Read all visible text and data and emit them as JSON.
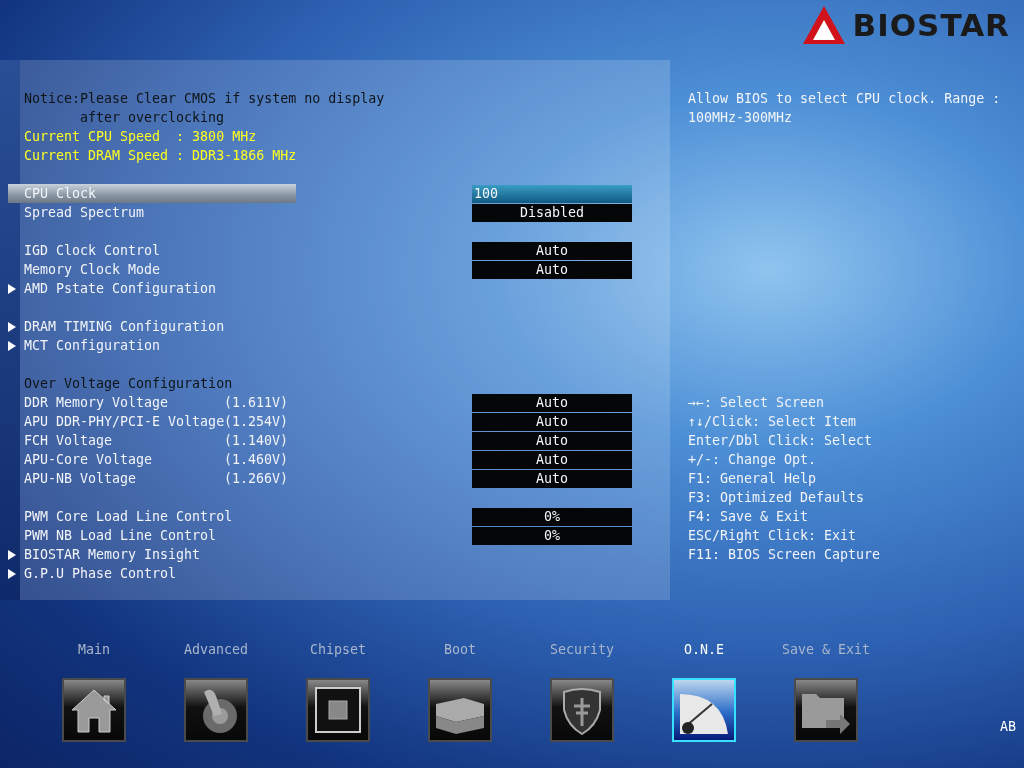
{
  "logo": {
    "text": "BIOSTAR"
  },
  "notice_lines": [
    "Notice:Please Clear CMOS if system no display",
    "after overclocking"
  ],
  "info_lines": [
    "Current CPU Speed  : 3800 MHz",
    "Current DRAM Speed : DDR3-1866 MHz"
  ],
  "sections": [
    {
      "items": [
        {
          "kind": "setting",
          "label": "CPU Clock",
          "value": "100",
          "selected": true
        },
        {
          "kind": "setting",
          "label": "Spread Spectrum",
          "value": "Disabled",
          "selected": false
        }
      ]
    },
    {
      "items": [
        {
          "kind": "setting",
          "label": "IGD Clock Control",
          "value": "Auto",
          "selected": false
        },
        {
          "kind": "setting",
          "label": "Memory Clock Mode",
          "value": "Auto",
          "selected": false
        },
        {
          "kind": "submenu",
          "label": "AMD Pstate Configuration",
          "selected": false
        }
      ]
    },
    {
      "items": [
        {
          "kind": "submenu",
          "label": "DRAM TIMING Configuration",
          "selected": false
        },
        {
          "kind": "submenu",
          "label": "MCT Configuration",
          "selected": false
        }
      ]
    },
    {
      "items": [
        {
          "kind": "header",
          "label": "Over Voltage Configuration"
        },
        {
          "kind": "setting",
          "label": "DDR Memory Voltage",
          "reading": "(1.611V)",
          "value": "Auto",
          "selected": false
        },
        {
          "kind": "setting",
          "label": "APU DDR-PHY/PCI-E Voltage",
          "reading": "(1.254V)",
          "value": "Auto",
          "selected": false
        },
        {
          "kind": "setting",
          "label": "FCH Voltage",
          "reading": "(1.140V)",
          "value": "Auto",
          "selected": false
        },
        {
          "kind": "setting",
          "label": "APU-Core Voltage",
          "reading": "(1.460V)",
          "value": "Auto",
          "selected": false
        },
        {
          "kind": "setting",
          "label": "APU-NB Voltage",
          "reading": "(1.266V)",
          "value": "Auto",
          "selected": false
        }
      ]
    },
    {
      "items": [
        {
          "kind": "setting",
          "label": "PWM Core Load Line Control",
          "value": "0%",
          "selected": false
        },
        {
          "kind": "setting",
          "label": "PWM NB Load Line Control",
          "value": "0%",
          "selected": false
        },
        {
          "kind": "submenu",
          "label": "BIOSTAR Memory Insight",
          "selected": false
        },
        {
          "kind": "submenu",
          "label": "G.P.U Phase Control",
          "selected": false
        }
      ]
    }
  ],
  "help_text": "Allow BIOS to select CPU clock. Range : 100MHz-300MHz",
  "key_legend": [
    "→←: Select Screen",
    "↑↓/Click: Select Item",
    "Enter/Dbl Click: Select",
    "+/-: Change Opt.",
    "F1: General Help",
    "F3: Optimized Defaults",
    "F4: Save & Exit",
    "ESC/Right Click: Exit",
    "F11: BIOS Screen Capture"
  ],
  "tabs": [
    {
      "label": "Main",
      "kind": "home",
      "selected": false
    },
    {
      "label": "Advanced",
      "kind": "joystick",
      "selected": false
    },
    {
      "label": "Chipset",
      "kind": "chip",
      "selected": false
    },
    {
      "label": "Boot",
      "kind": "drives",
      "selected": false
    },
    {
      "label": "Security",
      "kind": "shield",
      "selected": false
    },
    {
      "label": "O.N.E",
      "kind": "gauge",
      "selected": true
    },
    {
      "label": "Save & Exit",
      "kind": "folder",
      "selected": false
    }
  ],
  "status_badge": "AB"
}
